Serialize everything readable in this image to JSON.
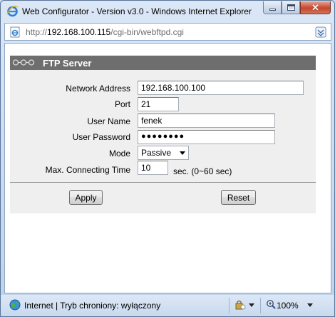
{
  "window": {
    "title": "Web Configurator - Version v3.0 - Windows Internet Explorer"
  },
  "address": {
    "url_prefix": "http://",
    "url_host": "192.168.100.115",
    "url_path": "/cgi-bin/webftpd.cgi"
  },
  "section": {
    "title": "FTP Server"
  },
  "form": {
    "network_address": {
      "label": "Network Address",
      "value": "192.168.100.100"
    },
    "port": {
      "label": "Port",
      "value": "21"
    },
    "user_name": {
      "label": "User Name",
      "value": "fenek"
    },
    "user_password": {
      "label": "User Password",
      "value": "●●●●●●●●"
    },
    "mode": {
      "label": "Mode",
      "value": "Passive"
    },
    "max_time": {
      "label": "Max. Connecting Time",
      "value": "10",
      "hint": "sec.  (0~60 sec)"
    }
  },
  "buttons": {
    "apply": "Apply",
    "reset": "Reset"
  },
  "status": {
    "zone_text": "Internet | Tryb chroniony: wyłączony",
    "zoom": "100%"
  },
  "colors": {
    "header_bg": "#6e6e6e",
    "panel_bg": "#efefef",
    "close_red": "#c6462c"
  }
}
